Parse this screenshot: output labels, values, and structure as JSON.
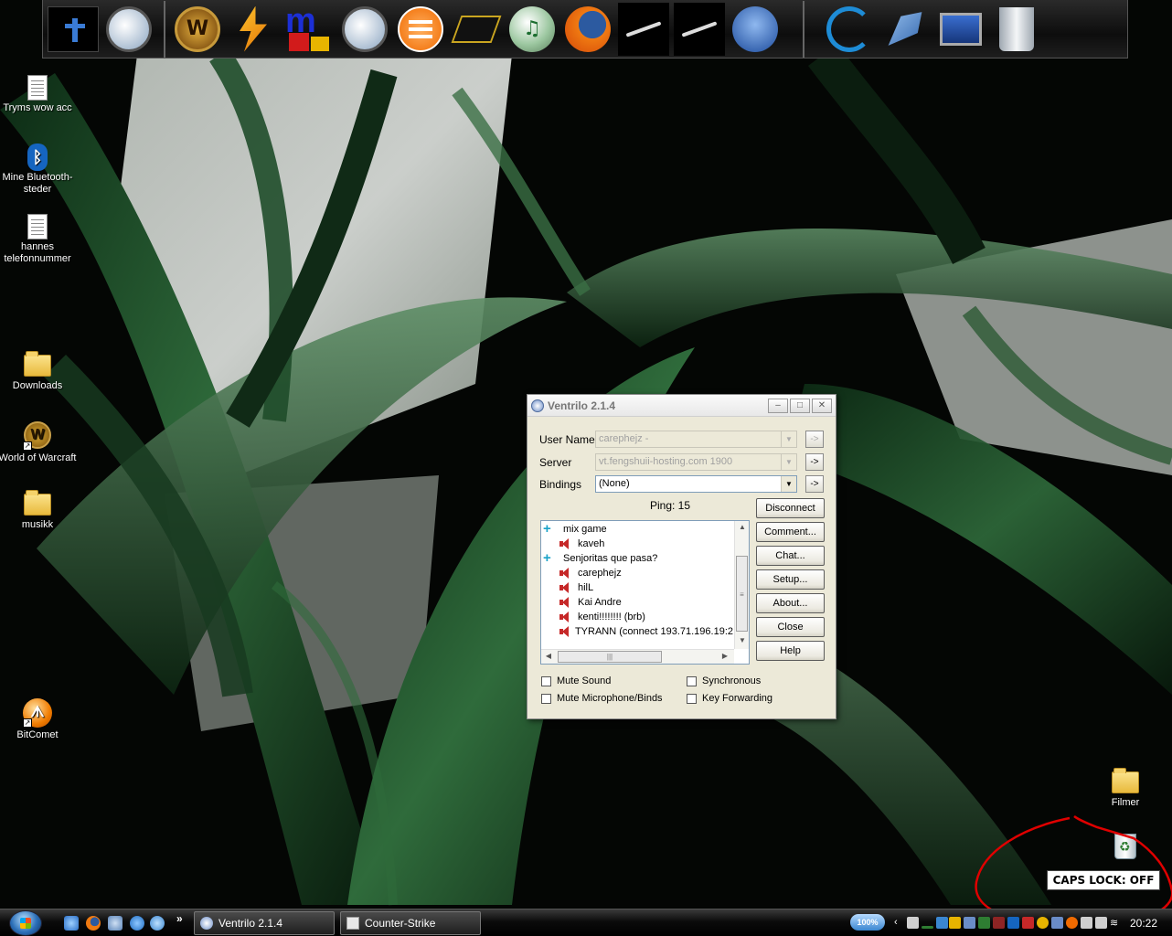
{
  "dock": {
    "items": [
      {
        "icon": "counter-strike-icon"
      },
      {
        "icon": "headset-icon"
      },
      {
        "icon": "world-of-warcraft-icon",
        "glyph": "W"
      },
      {
        "icon": "winamp-icon"
      },
      {
        "icon": "mirc-icon",
        "glyph": "m"
      },
      {
        "icon": "headset-icon"
      },
      {
        "icon": "vlc-menu-icon"
      },
      {
        "icon": "chip-icon"
      },
      {
        "icon": "itunes-icon",
        "glyph": "♫"
      },
      {
        "icon": "firefox-icon"
      },
      {
        "icon": "steam-icon"
      },
      {
        "icon": "steam-icon"
      },
      {
        "icon": "thunderbird-icon"
      },
      {
        "icon": "objectdock-icon"
      },
      {
        "icon": "pen-tool-icon"
      },
      {
        "icon": "monitor-icon"
      },
      {
        "icon": "recycle-bin-icon"
      }
    ]
  },
  "desktop": {
    "icons": [
      {
        "label": "Tryms wow acc",
        "icon": "text-document-icon"
      },
      {
        "label": "Mine Bluetooth-steder",
        "icon": "bluetooth-icon"
      },
      {
        "label": "hannes telefonnummer",
        "icon": "text-document-icon"
      },
      {
        "label": "Downloads",
        "icon": "folder-icon"
      },
      {
        "label": "World of Warcraft",
        "icon": "world-of-warcraft-icon"
      },
      {
        "label": "musikk",
        "icon": "folder-icon"
      },
      {
        "label": "BitComet",
        "icon": "bitcomet-icon"
      },
      {
        "label": "Filmer",
        "icon": "folder-icon"
      },
      {
        "label": "",
        "icon": "recycle-bin-icon"
      }
    ]
  },
  "ventrilo": {
    "title": "Ventrilo 2.1.4",
    "user_name_label": "User Name",
    "user_name_value": "carephejz -",
    "server_label": "Server",
    "server_value": "vt.fengshuii-hosting.com 1900",
    "bindings_label": "Bindings",
    "bindings_value": "(None)",
    "arrow_label": "->",
    "ping": "Ping: 15",
    "buttons": [
      "Disconnect",
      "Comment...",
      "Chat...",
      "Setup...",
      "About...",
      "Close",
      "Help"
    ],
    "tree": [
      {
        "type": "channel",
        "name": "mix game"
      },
      {
        "type": "user",
        "name": "kaveh"
      },
      {
        "type": "channel",
        "name": "Senjoritas que pasa?"
      },
      {
        "type": "user",
        "name": "carephejz"
      },
      {
        "type": "user",
        "name": "hilL"
      },
      {
        "type": "user",
        "name": "Kai Andre"
      },
      {
        "type": "user",
        "name": "kenti!!!!!!!! (brb)"
      },
      {
        "type": "user",
        "name": "TYRANN (connect 193.71.196.19:2"
      }
    ],
    "checkboxes": {
      "mute_sound": "Mute Sound",
      "mute_mic": "Mute Microphone/Binds",
      "synchronous": "Synchronous",
      "key_forwarding": "Key Forwarding"
    }
  },
  "caps_lock": "CAPS LOCK: OFF",
  "taskbar": {
    "quick_launch_more": "»",
    "tasks": [
      {
        "label": "Ventrilo 2.1.4",
        "icon": "ventrilo-icon"
      },
      {
        "label": "Counter-Strike",
        "icon": "counter-strike-icon"
      }
    ],
    "zoom": "100%",
    "clock": "20:22"
  }
}
